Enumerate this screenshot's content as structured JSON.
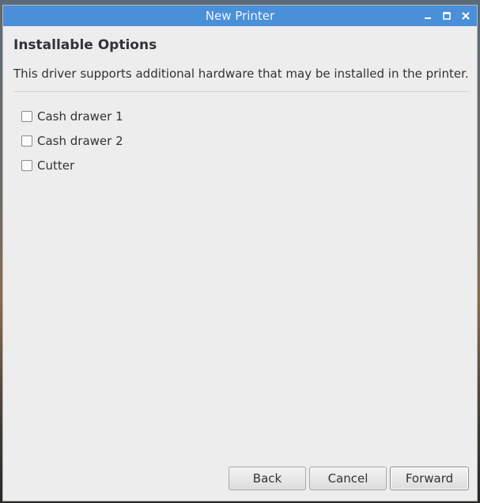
{
  "window": {
    "title": "New Printer",
    "controls": {
      "minimize_icon": "minimize-icon",
      "maximize_icon": "maximize-icon",
      "close_icon": "close-icon"
    },
    "titlebar_color": "#4a90d9"
  },
  "page": {
    "heading": "Installable Options",
    "description": "This driver supports additional hardware that may be installed in the printer.",
    "options": [
      {
        "label": "Cash drawer 1",
        "checked": false
      },
      {
        "label": "Cash drawer 2",
        "checked": false
      },
      {
        "label": "Cutter",
        "checked": false
      }
    ]
  },
  "footer": {
    "back_label": "Back",
    "cancel_label": "Cancel",
    "forward_label": "Forward"
  }
}
